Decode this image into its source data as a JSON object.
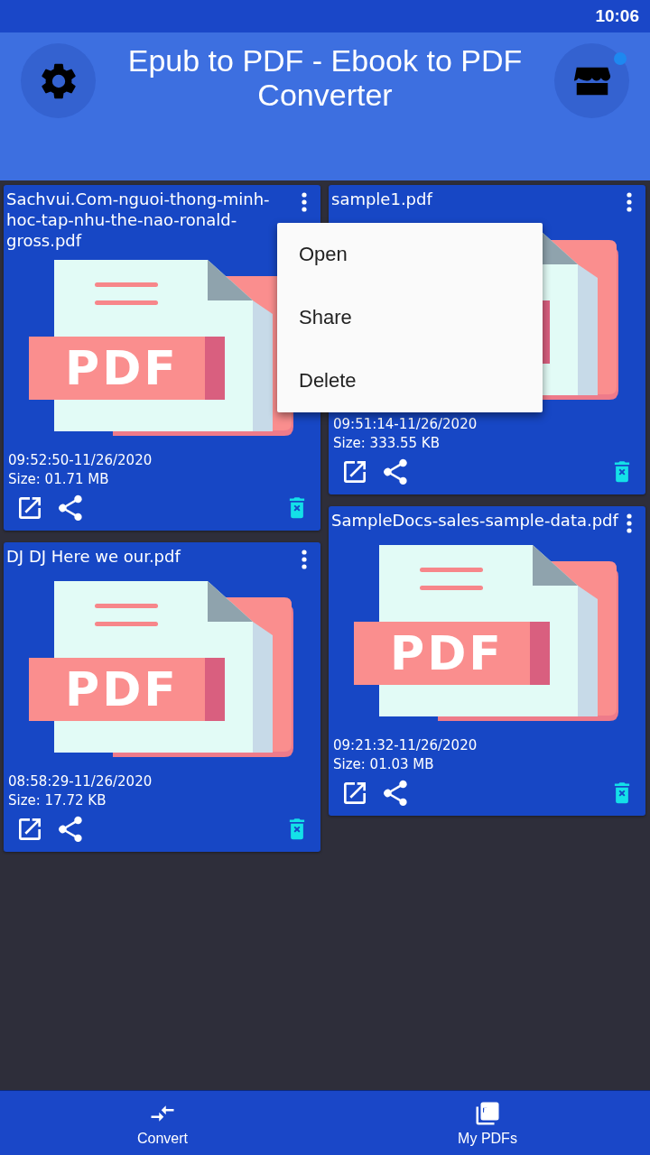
{
  "status_bar": {
    "time": "10:06"
  },
  "header": {
    "title": "Epub to PDF - Ebook to PDF Converter",
    "store_notification": true
  },
  "cards": [
    {
      "title": "Sachvui.Com-nguoi-thong-minh-hoc-tap-nhu-the-nao-ronald-gross.pdf",
      "thumbnail_label": "PDF",
      "time": "09:52:50-11/26/2020",
      "size": "Size: 01.71 MB"
    },
    {
      "title": "sample1.pdf",
      "time": "09:51:14-11/26/2020",
      "size": "Size: 333.55 KB",
      "menu": [
        "Open",
        "Share",
        "Delete"
      ]
    },
    {
      "title": "DJ DJ Here we our.pdf",
      "thumbnail_label": "PDF",
      "time": "08:58:29-11/26/2020",
      "size": "Size: 17.72 KB"
    },
    {
      "title": "SampleDocs-sales-sample-data.pdf",
      "thumbnail_label": "PDF",
      "time": "09:21:32-11/26/2020",
      "size": "Size: 01.03 MB"
    }
  ],
  "bottom_nav": [
    {
      "label": "Convert",
      "kind": "convert"
    },
    {
      "label": "My PDFs",
      "kind": "pdfs"
    }
  ]
}
